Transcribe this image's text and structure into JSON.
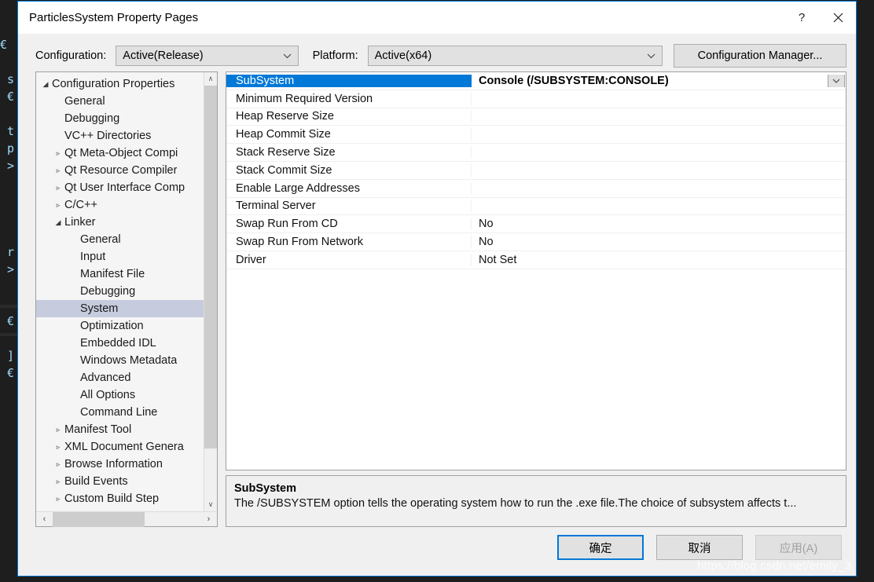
{
  "window": {
    "title": "ParticlesSystem Property Pages",
    "help_label": "?",
    "close_label": "✕"
  },
  "config_bar": {
    "configuration_label": "Configuration:",
    "configuration_value": "Active(Release)",
    "platform_label": "Platform:",
    "platform_value": "Active(x64)",
    "configuration_manager_label": "Configuration Manager..."
  },
  "tree": {
    "items": [
      {
        "label": "Configuration Properties",
        "depth": 0,
        "arrow": "◢",
        "selected": false
      },
      {
        "label": "General",
        "depth": 1,
        "arrow": "",
        "selected": false
      },
      {
        "label": "Debugging",
        "depth": 1,
        "arrow": "",
        "selected": false
      },
      {
        "label": "VC++ Directories",
        "depth": 1,
        "arrow": "",
        "selected": false
      },
      {
        "label": "Qt Meta-Object Compi",
        "depth": 1,
        "arrow": "▹",
        "selected": false
      },
      {
        "label": "Qt Resource Compiler",
        "depth": 1,
        "arrow": "▹",
        "selected": false
      },
      {
        "label": "Qt User Interface Comp",
        "depth": 1,
        "arrow": "▹",
        "selected": false
      },
      {
        "label": "C/C++",
        "depth": 1,
        "arrow": "▹",
        "selected": false
      },
      {
        "label": "Linker",
        "depth": 1,
        "arrow": "◢",
        "selected": false
      },
      {
        "label": "General",
        "depth": 2,
        "arrow": "",
        "selected": false
      },
      {
        "label": "Input",
        "depth": 2,
        "arrow": "",
        "selected": false
      },
      {
        "label": "Manifest File",
        "depth": 2,
        "arrow": "",
        "selected": false
      },
      {
        "label": "Debugging",
        "depth": 2,
        "arrow": "",
        "selected": false
      },
      {
        "label": "System",
        "depth": 2,
        "arrow": "",
        "selected": true
      },
      {
        "label": "Optimization",
        "depth": 2,
        "arrow": "",
        "selected": false
      },
      {
        "label": "Embedded IDL",
        "depth": 2,
        "arrow": "",
        "selected": false
      },
      {
        "label": "Windows Metadata",
        "depth": 2,
        "arrow": "",
        "selected": false
      },
      {
        "label": "Advanced",
        "depth": 2,
        "arrow": "",
        "selected": false
      },
      {
        "label": "All Options",
        "depth": 2,
        "arrow": "",
        "selected": false
      },
      {
        "label": "Command Line",
        "depth": 2,
        "arrow": "",
        "selected": false
      },
      {
        "label": "Manifest Tool",
        "depth": 1,
        "arrow": "▹",
        "selected": false
      },
      {
        "label": "XML Document Genera",
        "depth": 1,
        "arrow": "▹",
        "selected": false
      },
      {
        "label": "Browse Information",
        "depth": 1,
        "arrow": "▹",
        "selected": false
      },
      {
        "label": "Build Events",
        "depth": 1,
        "arrow": "▹",
        "selected": false
      },
      {
        "label": "Custom Build Step",
        "depth": 1,
        "arrow": "▹",
        "selected": false
      }
    ],
    "scroll_up_glyph": "∧",
    "scroll_down_glyph": "∨",
    "scroll_left_glyph": "‹",
    "scroll_right_glyph": "›"
  },
  "grid": {
    "rows": [
      {
        "name": "SubSystem",
        "value": "Console (/SUBSYSTEM:CONSOLE)",
        "selected": true
      },
      {
        "name": "Minimum Required Version",
        "value": "",
        "selected": false
      },
      {
        "name": "Heap Reserve Size",
        "value": "",
        "selected": false
      },
      {
        "name": "Heap Commit Size",
        "value": "",
        "selected": false
      },
      {
        "name": "Stack Reserve Size",
        "value": "",
        "selected": false
      },
      {
        "name": "Stack Commit Size",
        "value": "",
        "selected": false
      },
      {
        "name": "Enable Large Addresses",
        "value": "",
        "selected": false
      },
      {
        "name": "Terminal Server",
        "value": "",
        "selected": false
      },
      {
        "name": "Swap Run From CD",
        "value": "No",
        "selected": false
      },
      {
        "name": "Swap Run From Network",
        "value": "No",
        "selected": false
      },
      {
        "name": "Driver",
        "value": "Not Set",
        "selected": false
      }
    ],
    "value_dropdown_glyph": "∨"
  },
  "description": {
    "title": "SubSystem",
    "text": "The /SUBSYSTEM option tells the operating system how to run the .exe file.The choice of subsystem affects t..."
  },
  "footer": {
    "ok_label": "确定",
    "cancel_label": "取消",
    "apply_label": "应用(A)"
  },
  "watermark": "https://blog.csdn.net/emily_3",
  "backdrop": {
    "code_chars": "€\n\n s\n €\n\n t\n p\n >\n\n\n\n\n r\n >\n\n\n €\n\n ]\n €"
  },
  "colors": {
    "accent": "#0078d7",
    "selection_blue": "#0078d7",
    "tree_selection": "#c6cbdd",
    "dialog_bg": "#f0f0f0",
    "editor_bg": "#1e1e1e"
  }
}
